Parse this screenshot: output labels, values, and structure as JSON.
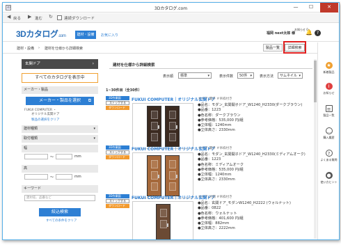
{
  "window": {
    "title": "3Dカタログ.com",
    "app_icon": "3D",
    "min": "—",
    "max": "☐",
    "close": "✕"
  },
  "nav": {
    "back": "戻る",
    "forward": "進む",
    "reload_icon": "↻",
    "cont_dl": "連続ダウンロード"
  },
  "header": {
    "logo": "3Dカタログ",
    "logo_suffix": ".com",
    "tab_active": "建材・設備",
    "tab_fav": "お気に入り",
    "user": "福岡 next太郎 様",
    "bell_count": "お知らせ 0"
  },
  "breadcrumb": {
    "items": [
      "建材・設備",
      "建材を仕様から詳細検索"
    ],
    "btn_list": "製品一覧",
    "btn_detail": "詳細検索"
  },
  "sidebar": {
    "head": "玄関ドア",
    "all_cat": "すべてのカタログを表示中",
    "maker_sec": "メーカー・製品",
    "maker_btn": "メーカー・製品を選択",
    "maker_text1": "FUKUI COMPUTER ・",
    "maker_text2": "オリジナル玄関ドア",
    "clear1": "製品の選択をクリア",
    "sec_type": "建材種類",
    "sec_install": "取付種類",
    "width": "幅",
    "height": "高",
    "mm": "mm",
    "tilde": "〜",
    "keyword": "キーワード",
    "kw_placeholder": "建材名、品番など",
    "search_btn": "絞込検索",
    "clear_all": "すべての条件をクリア"
  },
  "main": {
    "title": "建材を仕様から詳細検索",
    "order_label": "表示順",
    "order_value": "標準",
    "count_label": "表示件数",
    "count_value": "50件",
    "method_label": "表示方法",
    "method_value": "サムネイル",
    "result_count": "1~30件目（全30件）"
  },
  "items": [
    {
      "maker": "FUKUI COMPUTER｜オリジナル玄関ドア",
      "tags": "＃ドア_開子 ＃吊枠付き",
      "actions": [
        "3D作業図",
        "ストックする",
        "ダウンロード"
      ],
      "specs": [
        "●品名：モダン_玄関開子ドア_W1240_H2330(ダークブラウン)",
        "●品番：1223",
        "●色名称：ダークブラウン",
        "●参考価格：535,000 円/組",
        "●立体幅：1240mm",
        "●立体高さ：2330mm"
      ],
      "color": "dark"
    },
    {
      "maker": "FUKUI COMPUTER｜オリジナル玄関ドア",
      "tags": "＃ドア_開子 ＃吊枠付き",
      "actions": [
        "3D作業図",
        "ストックする",
        "ダウンロード"
      ],
      "specs": [
        "●品名：モダン_玄関開子ドア_W1240_H2330(ミディアムオーク)",
        "●品番：1223",
        "●色名称：ミディアムオーク",
        "●参考価格：535,000 円/組",
        "●立体幅：1240mm",
        "●立体高さ：2330mm"
      ],
      "color": "oak"
    },
    {
      "maker": "FUKUI COMPUTER｜オリジナル玄関ドア",
      "tags": "＃ドア_片開 ＃吊枠付き",
      "actions": [
        "3D作業図",
        "ストックする",
        "ダウンロード"
      ],
      "specs": [
        "●品名：玄関ドア_モダンW1240_H2222 (ウォルナット)",
        "●品番：0822",
        "●色名称：ウォルナット",
        "●参考価格：401,600 円/組",
        "●立体幅：882mm",
        "●立体高さ：2222mm"
      ],
      "color": "walnut"
    }
  ],
  "rail": [
    "新着製品",
    "お知らせ",
    "製品一覧",
    "購入履歴",
    "よくある質問",
    "使い方ヒント"
  ],
  "colors": {
    "accent": "#2d7fd4",
    "download": "#f29a2e",
    "highlight": "#e02020"
  }
}
